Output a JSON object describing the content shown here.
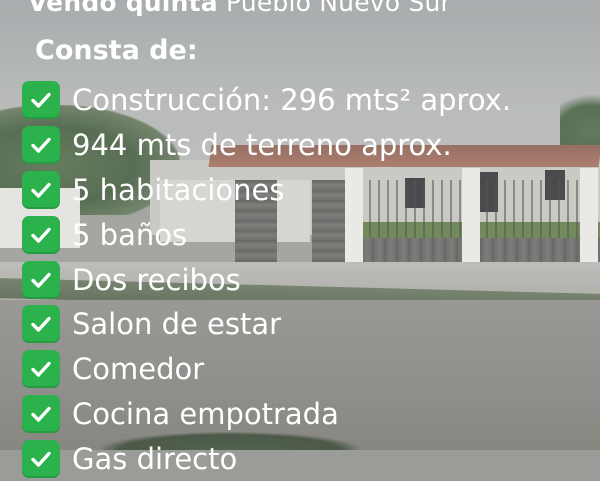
{
  "heading": {
    "bold": "Vendo quinta",
    "rest": " Pueblo Nuevo Sur"
  },
  "subheading": "Consta de:",
  "check_icon": "white-heavy-check-mark-icon",
  "check_color": "#2bb24c",
  "features": [
    "Construcción: 296 mts² aprox.",
    "944 mts de terreno aprox.",
    "5 habitaciones",
    "5 baños",
    "Dos recibos",
    "Salon de estar",
    "Comedor",
    "Cocina empotrada",
    "Gas directo"
  ]
}
